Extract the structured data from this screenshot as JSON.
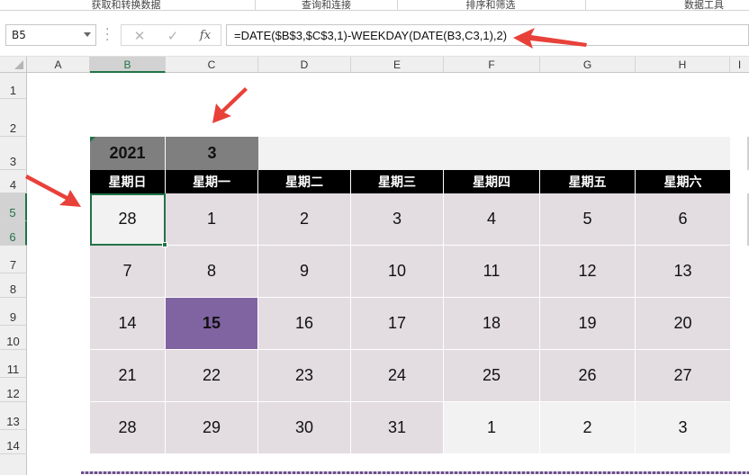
{
  "ribbon": {
    "groups": [
      "获取和转换数据",
      "查询和连接",
      "排序和筛选",
      "数据工具"
    ]
  },
  "formula_bar": {
    "name_box": "B5",
    "cancel_icon": "✕",
    "enter_icon": "✓",
    "function_icon": "fx",
    "formula": "=DATE($B$3,$C$3,1)-WEEKDAY(DATE(B3,C3,1),2)"
  },
  "columns": [
    "A",
    "B",
    "C",
    "D",
    "E",
    "F",
    "G",
    "H",
    "I"
  ],
  "rows": [
    "1",
    "2",
    "3",
    "4",
    "5",
    "6",
    "7",
    "8",
    "9",
    "10",
    "11",
    "12",
    "13",
    "14"
  ],
  "calendar": {
    "year": "2021",
    "month": "3",
    "weekdays": [
      "星期日",
      "星期一",
      "星期二",
      "星期三",
      "星期四",
      "星期五",
      "星期六"
    ],
    "weeks": [
      [
        "28",
        "1",
        "2",
        "3",
        "4",
        "5",
        "6"
      ],
      [
        "7",
        "8",
        "9",
        "10",
        "11",
        "12",
        "13"
      ],
      [
        "14",
        "15",
        "16",
        "17",
        "18",
        "19",
        "20"
      ],
      [
        "21",
        "22",
        "23",
        "24",
        "25",
        "26",
        "27"
      ],
      [
        "28",
        "29",
        "30",
        "31",
        "1",
        "2",
        "3"
      ]
    ],
    "out_of_month": [
      [
        0,
        0
      ],
      [
        4,
        4
      ],
      [
        4,
        5
      ],
      [
        4,
        6
      ]
    ],
    "highlighted": [
      2,
      1
    ],
    "colors": {
      "in_month_bg": "#e3dce1",
      "out_month_bg": "#f2f2f2",
      "highlight_bg": "#8064a2",
      "header_bg": "#000000",
      "title_bg": "#7f7f7f",
      "arrow": "#e8413a",
      "selection": "#217346"
    }
  }
}
